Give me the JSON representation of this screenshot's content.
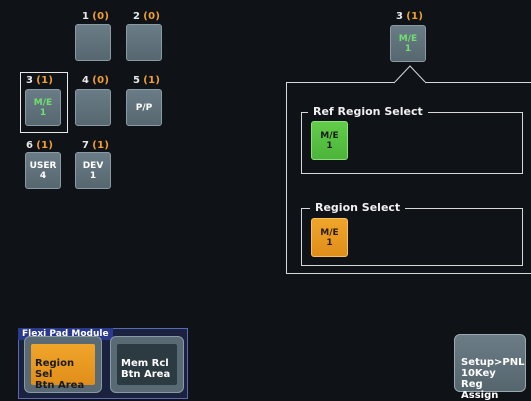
{
  "slots": [
    {
      "id": "1",
      "count": "(0)",
      "text": ""
    },
    {
      "id": "2",
      "count": "(0)",
      "text": ""
    },
    {
      "id": "3",
      "count": "(1)",
      "text": "M/E\n1"
    },
    {
      "id": "4",
      "count": "(0)",
      "text": ""
    },
    {
      "id": "5",
      "count": "(1)",
      "text": "P/P"
    },
    {
      "id": "6",
      "count": "(1)",
      "text": "USER\n4"
    },
    {
      "id": "7",
      "count": "(1)",
      "text": "DEV\n1"
    }
  ],
  "selected": {
    "id": "3",
    "count": "(1)",
    "text": "M/E\n1"
  },
  "ref_region": {
    "title": "Ref Region Select",
    "button": "M/E\n1"
  },
  "region": {
    "title": "Region Select",
    "button": "M/E\n1"
  },
  "flexi": {
    "title": "Flexi Pad Module",
    "region_sel": "Region Sel\nBtn Area",
    "mem_rcl": "Mem Rcl\nBtn Area"
  },
  "setup": {
    "label": "Setup>PNL\n10Key Reg\nAssign"
  },
  "colors": {
    "background": "#0f1217",
    "count_orange": "#f0a030",
    "active_green": "#4cb53a",
    "active_orange": "#e08e1a",
    "flexi_blue": "#2b3a8c"
  }
}
